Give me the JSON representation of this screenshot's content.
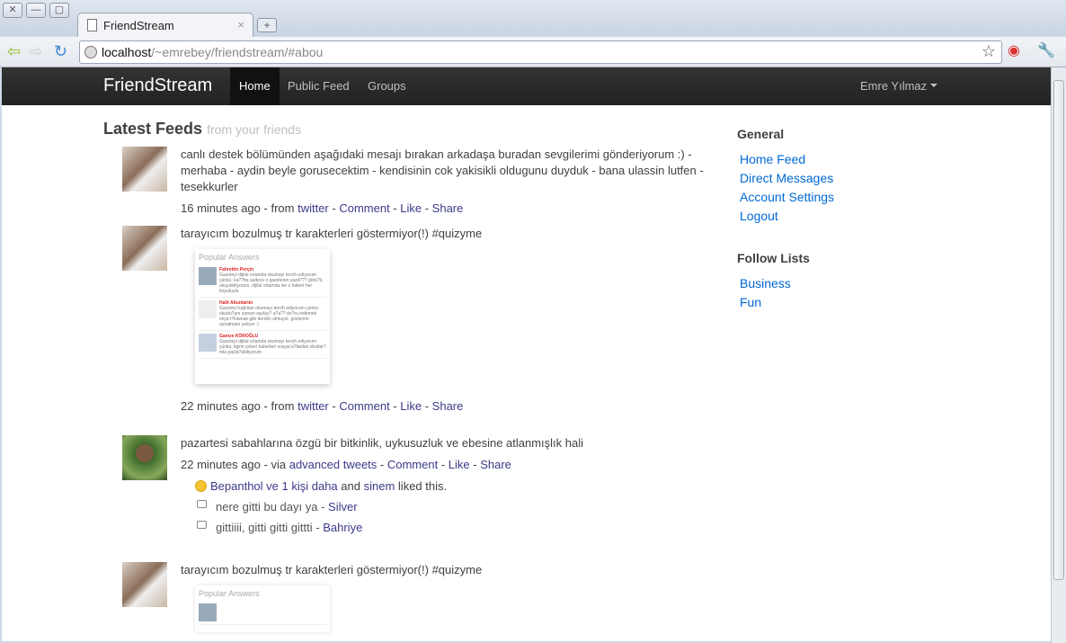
{
  "browser": {
    "tab_title": "FriendStream",
    "url_host": "localhost",
    "url_path": "/~emrebey/friendstream/#abou"
  },
  "navbar": {
    "brand": "FriendStream",
    "items": [
      "Home",
      "Public Feed",
      "Groups"
    ],
    "active": "Home",
    "user": "Emre Yılmaz"
  },
  "main": {
    "title": "Latest Feeds",
    "subtitle": "from your friends"
  },
  "feeds": [
    {
      "text": "canlı destek bölümünden aşağıdaki mesajı bırakan arkadaşa buradan sevgilerimi gönderiyorum :) - merhaba - aydin beyle gorusecektim - kendisinin cok yakisikli oldugunu duyduk - bana ulassin lutfen - tesekkurler",
      "time": "16 minutes ago",
      "via": "from",
      "source": "twitter",
      "actions": [
        "Comment",
        "Like",
        "Share"
      ]
    },
    {
      "text": "tarayıcım bozulmuş tr karakterleri göstermiyor(!) #quizyme",
      "time": "22 minutes ago",
      "via": "from",
      "source": "twitter",
      "actions": [
        "Comment",
        "Like",
        "Share"
      ],
      "image": {
        "heading": "Popular Answers",
        "answers": [
          {
            "name": "Fahrettin Perçin",
            "text": "Gazeteyi dijital ortamda okumayı tercih ediyorum çünkü: ka??tta sadece o gazetenin yazd??? görü?ü okuyabiliyorum, dijital ortamda ise o haberi her boyutuyla"
          },
          {
            "name": "Halit Altuntarim",
            "text": "Gazeteyi kağıttan okumayı tercih ediyorum çünkü: okudu?um zaman sayfay? a?a?? do?ru indirmek veya t?klamak gibi derdim olmuyor. gözlerimi oynatmam yetiyor :)"
          },
          {
            "name": "Gamze KÖROĞLU",
            "text": "Gazeteyi dijital ortamda okumayı tercih ediyorum çünkü: ilgimi çeken haberleri sosyal a?lardan dostlar?mla payla?abiliyorum"
          }
        ]
      }
    },
    {
      "text": "pazartesi sabahlarına özgü bir bitkinlik, uykusuzluk ve ebesine atlanmışlık hali",
      "time": "22 minutes ago",
      "via": "via",
      "source": "advanced tweets",
      "actions": [
        "Comment",
        "Like",
        "Share"
      ],
      "likes": {
        "who": "Bepanthol ve 1 kişi daha",
        "and": "and",
        "who2": "sinem",
        "suffix": "liked this."
      },
      "comments": [
        {
          "text": "nere gitti bu dayı ya",
          "author": "Silver"
        },
        {
          "text": "gittiiii, gitti gitti gittti",
          "author": "Bahriye"
        }
      ]
    },
    {
      "text": "tarayıcım bozulmuş tr karakterleri göstermiyor(!) #quizyme",
      "image_heading": "Popular Answers"
    }
  ],
  "sidebar": {
    "general_title": "General",
    "general": [
      "Home Feed",
      "Direct Messages",
      "Account Settings",
      "Logout"
    ],
    "follow_title": "Follow Lists",
    "follow": [
      "Business",
      "Fun"
    ]
  }
}
